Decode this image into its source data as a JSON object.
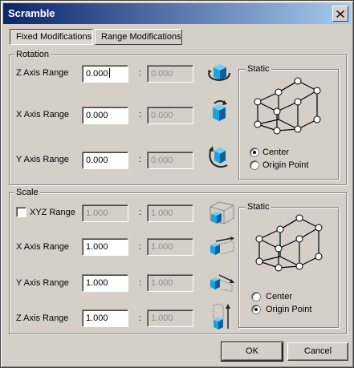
{
  "window": {
    "title": "Scramble"
  },
  "tabs": [
    {
      "label": "Fixed Modifications",
      "active": true
    },
    {
      "label": "Range Modifications",
      "active": false
    }
  ],
  "rotation": {
    "group_label": "Rotation",
    "rows": [
      {
        "label": "Z Axis Range",
        "value": "0.000",
        "range_value": "0.000",
        "icon": "rotate-z-icon"
      },
      {
        "label": "X Axis Range",
        "value": "0.000",
        "range_value": "0.000",
        "icon": "rotate-x-icon"
      },
      {
        "label": "Y Axis Range",
        "value": "0.000",
        "range_value": "0.000",
        "icon": "rotate-y-icon"
      }
    ],
    "static": {
      "label": "Static",
      "options": [
        {
          "label": "Center",
          "selected": true
        },
        {
          "label": "Origin Point",
          "selected": false
        }
      ]
    }
  },
  "scale": {
    "group_label": "Scale",
    "xyz": {
      "label": "XYZ Range",
      "checked": false,
      "value": "1.000",
      "range_value": "1.000",
      "icon": "scale-xyz-icon"
    },
    "rows": [
      {
        "label": "X Axis Range",
        "value": "1.000",
        "range_value": "1.000",
        "icon": "scale-x-icon"
      },
      {
        "label": "Y Axis Range",
        "value": "1.000",
        "range_value": "1.000",
        "icon": "scale-y-icon"
      },
      {
        "label": "Z Axis Range",
        "value": "1.000",
        "range_value": "1.000",
        "icon": "scale-z-icon"
      }
    ],
    "static": {
      "label": "Static",
      "options": [
        {
          "label": "Center",
          "selected": false
        },
        {
          "label": "Origin Point",
          "selected": true
        }
      ]
    }
  },
  "colon": ":",
  "buttons": {
    "ok": "OK",
    "cancel": "Cancel"
  },
  "colors": {
    "cube": "#1aa3e0",
    "cube_dark": "#0a5f9a",
    "titlebar_start": "#0a246a",
    "titlebar_end": "#a6caf0"
  }
}
